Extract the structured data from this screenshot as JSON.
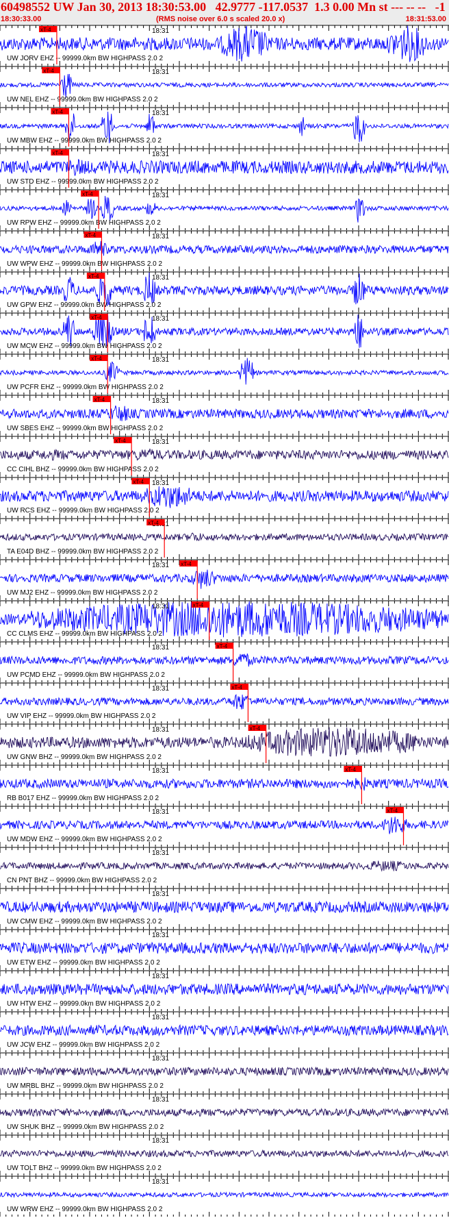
{
  "header": {
    "title": "60498552 UW Jan 30, 2013 18:30:53.00   42.9777 -117.0537  1.3 0.00 Mn st --- -- --   -1",
    "start_time": "18:30:33.00",
    "end_time": "18:31:53.00",
    "note": "(RMS noise over 6.0 s scaled 20.0 x)"
  },
  "colors": {
    "header_bg": "#ececec",
    "header_text": "#e00000",
    "trace_ehz": "#0000ff",
    "trace_bhz": "#1e0a5a",
    "pick": "#ff0000",
    "axis": "#000000"
  },
  "chart_data": {
    "type": "seismogram",
    "time_window": [
      "18:30:33.00",
      "18:31:53.00"
    ],
    "minute_marker": "18:31",
    "pick_label": "xT-4",
    "filter_text": "99999.0km BW  HIGHPASS  2.0  2",
    "traces": [
      {
        "label": "UW JORV EHZ --",
        "component": "EHZ",
        "pick_s": 19.0,
        "events": [
          [
            74,
            90,
            1.0
          ],
          [
            130,
            143,
            1.0
          ]
        ],
        "noise": 0.35
      },
      {
        "label": "UW NEL EHZ --",
        "component": "EHZ",
        "pick_s": 20.0,
        "events": [
          [
            20,
            24,
            0.8
          ]
        ],
        "noise": 0.12
      },
      {
        "label": "UW MBW EHZ --",
        "component": "EHZ",
        "pick_s": 23.0,
        "events": [
          [
            22,
            25,
            1.0
          ],
          [
            34,
            38,
            1.0
          ],
          [
            49,
            52,
            0.85
          ],
          [
            100,
            102,
            0.6
          ],
          [
            118,
            122,
            1.0
          ]
        ],
        "noise": 0.12
      },
      {
        "label": "UW STD EHZ --",
        "component": "EHZ",
        "pick_s": 23.0,
        "events": [
          [
            22,
            30,
            0.5
          ]
        ],
        "noise": 0.35
      },
      {
        "label": "UW RPW EHZ --",
        "component": "EHZ",
        "pick_s": 33.0,
        "events": [
          [
            21,
            24,
            0.5
          ],
          [
            29,
            32,
            0.7
          ],
          [
            34,
            38,
            0.8
          ],
          [
            49,
            52,
            0.5
          ],
          [
            119,
            122,
            0.9
          ]
        ],
        "noise": 0.12
      },
      {
        "label": "UW WPW EHZ --",
        "component": "EHZ",
        "pick_s": 34.0,
        "events": [
          [
            30,
            36,
            0.5
          ]
        ],
        "noise": 0.22
      },
      {
        "label": "UW GPW EHZ --",
        "component": "EHZ",
        "pick_s": 35.0,
        "events": [
          [
            21,
            25,
            0.8
          ],
          [
            32,
            38,
            1.0
          ],
          [
            48,
            52,
            1.0
          ],
          [
            118,
            122,
            1.0
          ]
        ],
        "noise": 0.25
      },
      {
        "label": "UW MCW EHZ --",
        "component": "EHZ",
        "pick_s": 36.0,
        "events": [
          [
            21,
            25,
            1.0
          ],
          [
            31,
            38,
            1.0
          ],
          [
            48,
            52,
            1.0
          ],
          [
            118,
            122,
            1.0
          ]
        ],
        "noise": 0.2
      },
      {
        "label": "UW PCFR EHZ --",
        "component": "EHZ",
        "pick_s": 36.0,
        "events": [
          [
            35,
            40,
            0.6
          ],
          [
            80,
            85,
            0.8
          ]
        ],
        "noise": 0.12
      },
      {
        "label": "UW SBES EHZ --",
        "component": "EHZ",
        "pick_s": 37.0,
        "events": [
          [
            36,
            44,
            0.5
          ]
        ],
        "noise": 0.25
      },
      {
        "label": "CC CIHL BHZ --",
        "component": "BHZ",
        "pick_s": 44.0,
        "events": [
          [
            10,
            26,
            0.3
          ],
          [
            42,
            56,
            0.35
          ]
        ],
        "noise": 0.25
      },
      {
        "label": "UW RCS EHZ --",
        "component": "EHZ",
        "pick_s": 50.0,
        "events": [
          [
            48,
            65,
            0.7
          ]
        ],
        "noise": 0.3
      },
      {
        "label": "TA E04D BHZ --",
        "component": "BHZ",
        "pick_s": 55.0,
        "events": [
          [
            62,
            68,
            0.3
          ]
        ],
        "noise": 0.18
      },
      {
        "label": "UW MJ2 EHZ --",
        "component": "EHZ",
        "pick_s": 66.0,
        "events": [
          [
            64,
            72,
            0.6
          ]
        ],
        "noise": 0.22
      },
      {
        "label": "CC CLMS EHZ --",
        "component": "EHZ",
        "pick_s": 70.0,
        "events": [
          [
            10,
            148,
            1.0
          ]
        ],
        "noise": 0.3
      },
      {
        "label": "UW PCMD EHZ --",
        "component": "EHZ",
        "pick_s": 78.0,
        "events": [
          [
            78,
            84,
            0.5
          ]
        ],
        "noise": 0.22
      },
      {
        "label": "UW VIP EHZ --",
        "component": "EHZ",
        "pick_s": 83.0,
        "events": [
          [
            77,
            84,
            0.5
          ]
        ],
        "noise": 0.2
      },
      {
        "label": "UW GNW BHZ --",
        "component": "BHZ",
        "pick_s": 89.0,
        "events": [
          [
            82,
            142,
            0.85
          ]
        ],
        "noise": 0.3
      },
      {
        "label": "RB B017 EHZ --",
        "component": "EHZ",
        "pick_s": 121.0,
        "events": [
          [
            118,
            124,
            0.4
          ]
        ],
        "noise": 0.25
      },
      {
        "label": "UW MDW EHZ --",
        "component": "EHZ",
        "pick_s": 135.0,
        "events": [
          [
            128,
            136,
            0.6
          ]
        ],
        "noise": 0.22
      },
      {
        "label": "CN PNT BHZ --",
        "component": "BHZ",
        "pick_s": null,
        "events": [
          [
            120,
            138,
            0.3
          ]
        ],
        "noise": 0.18
      },
      {
        "label": "UW CMW EHZ --",
        "component": "EHZ",
        "pick_s": null,
        "events": [],
        "noise": 0.3
      },
      {
        "label": "UW ETW EHZ --",
        "component": "EHZ",
        "pick_s": null,
        "events": [],
        "noise": 0.3
      },
      {
        "label": "UW HTW EHZ --",
        "component": "EHZ",
        "pick_s": null,
        "events": [],
        "noise": 0.3
      },
      {
        "label": "UW JCW EHZ --",
        "component": "EHZ",
        "pick_s": null,
        "events": [],
        "noise": 0.28
      },
      {
        "label": "UW MRBL BHZ --",
        "component": "BHZ",
        "pick_s": null,
        "events": [],
        "noise": 0.22
      },
      {
        "label": "UW SHUK BHZ --",
        "component": "BHZ",
        "pick_s": null,
        "events": [],
        "noise": 0.2
      },
      {
        "label": "UW TOLT BHZ --",
        "component": "BHZ",
        "pick_s": null,
        "events": [],
        "noise": 0.18
      },
      {
        "label": "UW WRW EHZ --",
        "component": "EHZ",
        "pick_s": null,
        "events": [],
        "noise": 0.12
      }
    ]
  }
}
